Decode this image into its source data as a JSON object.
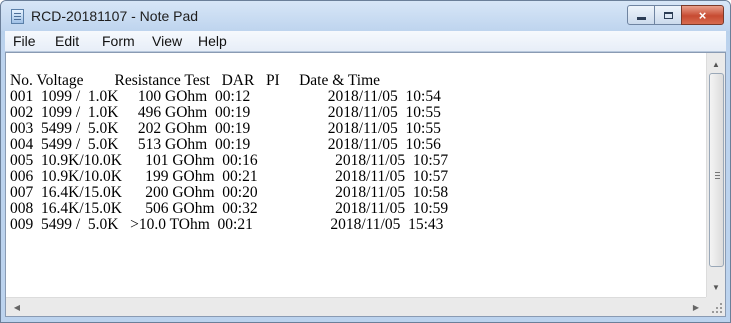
{
  "window": {
    "title": "RCD-20181107 - Note Pad",
    "icon": "notepad-icon"
  },
  "caption_buttons": {
    "minimize_icon": "minimize-icon",
    "maximize_icon": "maximize-icon",
    "close_label": "×"
  },
  "menu": [
    "File",
    "Edit",
    "Form",
    "View",
    "Help"
  ],
  "document": {
    "header": "No. Voltage        Resistance Test   DAR   PI     Date & Time",
    "lines": [
      "001  1099 /  1.0K     100 GOhm  00:12                    2018/11/05  10:54",
      "002  1099 /  1.0K     496 GOhm  00:19                    2018/11/05  10:55",
      "003  5499 /  5.0K     202 GOhm  00:19                    2018/11/05  10:55",
      "004  5499 /  5.0K     513 GOhm  00:19                    2018/11/05  10:56",
      "005  10.9K/10.0K      101 GOhm  00:16                    2018/11/05  10:57",
      "006  10.9K/10.0K      199 GOhm  00:21                    2018/11/05  10:57",
      "007  16.4K/15.0K      200 GOhm  00:20                    2018/11/05  10:58",
      "008  16.4K/15.0K      506 GOhm  00:32                    2018/11/05  10:59",
      "009  5499 /  5.0K   >10.0 TOhm  00:21                    2018/11/05  15:43"
    ]
  },
  "scrollbars": {
    "up": "▲",
    "down": "▼",
    "left": "◀",
    "right": "▶"
  }
}
